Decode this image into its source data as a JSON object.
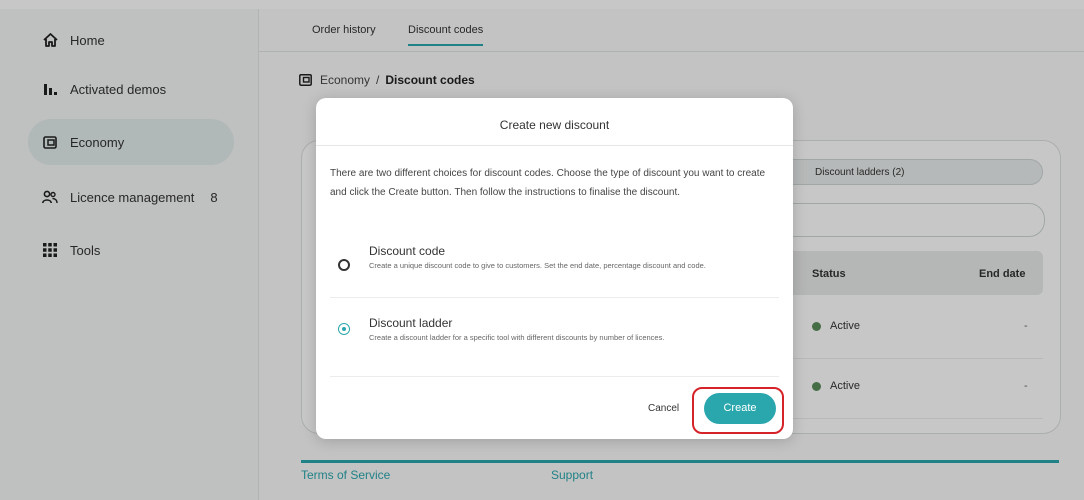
{
  "sidebar": {
    "items": [
      {
        "label": "Home",
        "icon": "home-icon"
      },
      {
        "label": "Activated demos",
        "icon": "bar-chart-icon"
      },
      {
        "label": "Economy",
        "icon": "wallet-icon",
        "active": true
      },
      {
        "label": "Licence management",
        "icon": "users-icon",
        "badge": "8"
      },
      {
        "label": "Tools",
        "icon": "grid-icon"
      }
    ]
  },
  "tabs": [
    {
      "label": "Order history"
    },
    {
      "label": "Discount codes",
      "active": true
    }
  ],
  "breadcrumb": {
    "parent": "Economy",
    "separator": "/",
    "current": "Discount codes"
  },
  "background": {
    "pill_label": "Discount ladders (2)",
    "table": {
      "headers": [
        "Status",
        "End date"
      ],
      "rows": [
        {
          "status": "Active",
          "end_date": "-"
        },
        {
          "status": "Active",
          "end_date": "-"
        }
      ]
    },
    "footer": {
      "terms": "Terms of Service",
      "support": "Support"
    }
  },
  "modal": {
    "title": "Create new discount",
    "description": "There are two different choices for discount codes. Choose the type of discount you want to create and click the Create button. Then follow the instructions to finalise the discount.",
    "options": [
      {
        "title": "Discount code",
        "description": "Create a unique discount code to give to customers. Set the end date, percentage discount and code.",
        "selected": false
      },
      {
        "title": "Discount ladder",
        "description": "Create a discount ladder for a specific tool with different discounts by number of licences.",
        "selected": true
      }
    ],
    "cancel_label": "Cancel",
    "create_label": "Create"
  },
  "colors": {
    "accent": "#2aa7ad",
    "highlight": "#d6232a",
    "active_dot": "#5a8d5a"
  }
}
